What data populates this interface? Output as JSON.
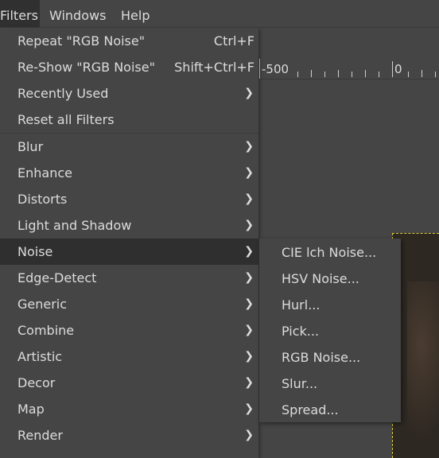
{
  "menubar": {
    "items": [
      {
        "label": "Filters"
      },
      {
        "label": "Windows"
      },
      {
        "label": "Help"
      }
    ]
  },
  "ruler": {
    "labels": [
      "-500",
      "0"
    ]
  },
  "filters_menu": {
    "items": [
      {
        "label": "Repeat \"RGB Noise\"",
        "accel": "Ctrl+F"
      },
      {
        "label": "Re-Show \"RGB Noise\"",
        "accel": "Shift+Ctrl+F"
      },
      {
        "label": "Recently Used",
        "submenu": true
      },
      {
        "label": "Reset all Filters"
      },
      {
        "label": "Blur",
        "submenu": true
      },
      {
        "label": "Enhance",
        "submenu": true
      },
      {
        "label": "Distorts",
        "submenu": true
      },
      {
        "label": "Light and Shadow",
        "submenu": true
      },
      {
        "label": "Noise",
        "submenu": true,
        "highlighted": true
      },
      {
        "label": "Edge-Detect",
        "submenu": true
      },
      {
        "label": "Generic",
        "submenu": true
      },
      {
        "label": "Combine",
        "submenu": true
      },
      {
        "label": "Artistic",
        "submenu": true
      },
      {
        "label": "Decor",
        "submenu": true
      },
      {
        "label": "Map",
        "submenu": true
      },
      {
        "label": "Render",
        "submenu": true
      }
    ],
    "chevron_icon": "chevron-right-icon"
  },
  "noise_submenu": {
    "items": [
      {
        "label": "CIE lch Noise..."
      },
      {
        "label": "HSV Noise..."
      },
      {
        "label": "Hurl..."
      },
      {
        "label": "Pick..."
      },
      {
        "label": "RGB Noise..."
      },
      {
        "label": "Slur..."
      },
      {
        "label": "Spread..."
      }
    ]
  },
  "colors": {
    "menu_bg": "#454545",
    "highlight_bg": "#2f2f2f",
    "text": "#dcdcdc",
    "selection_border": "#d8cc3a"
  }
}
